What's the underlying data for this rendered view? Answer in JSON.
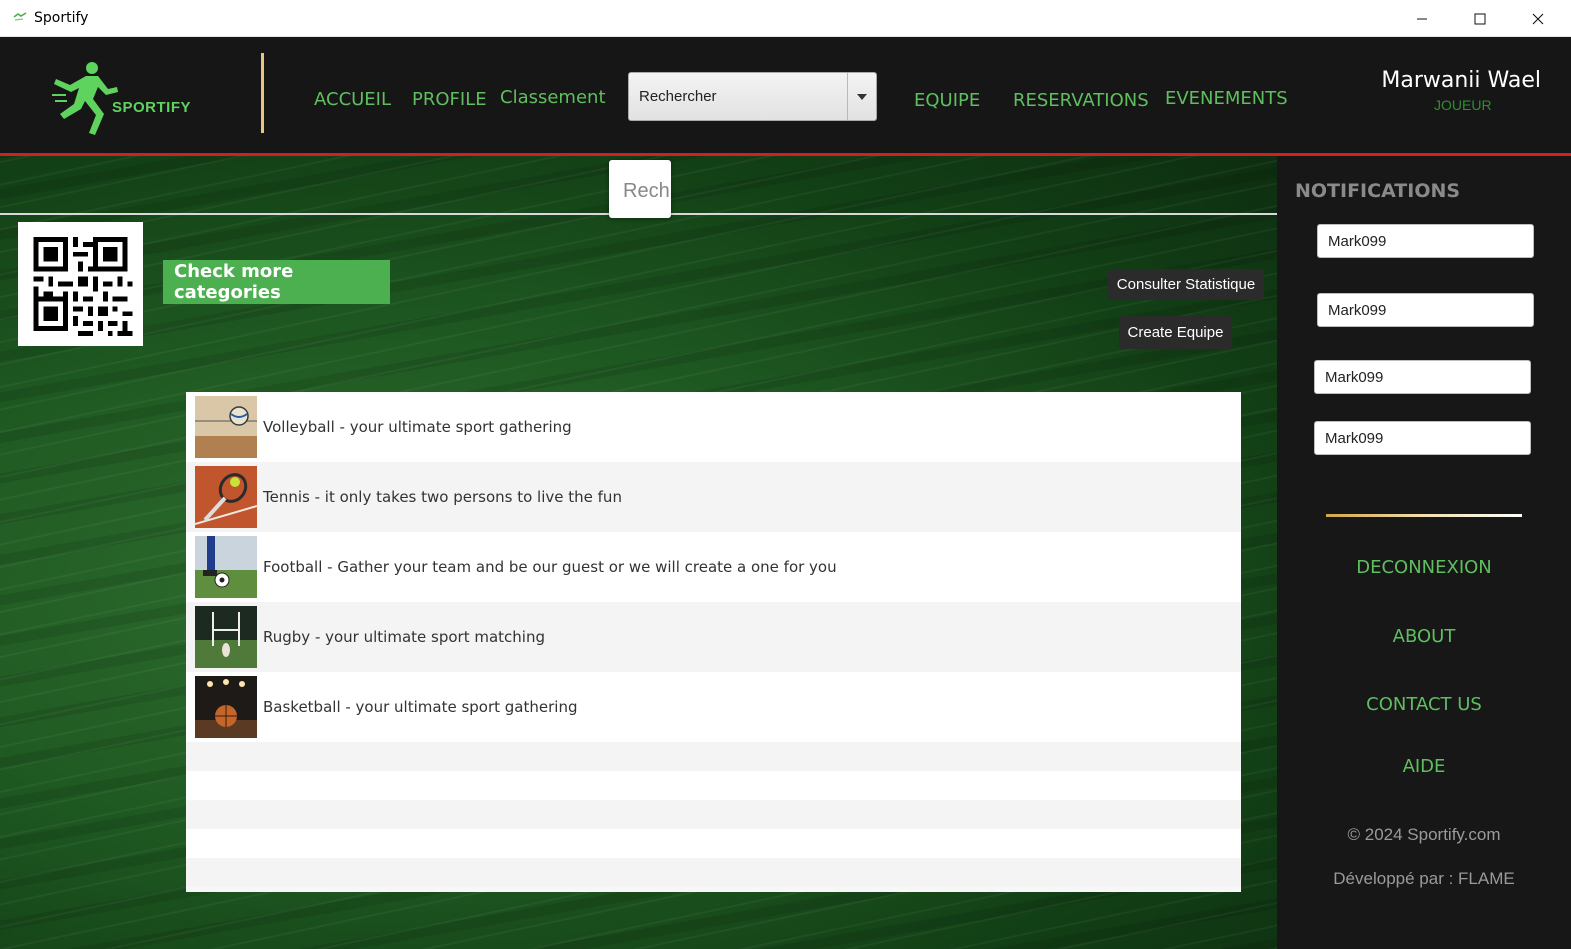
{
  "window": {
    "title": "Sportify"
  },
  "header": {
    "logo_text": "SPORTIFY",
    "nav": {
      "accueil": "ACCUEIL",
      "profile": "PROFILE",
      "classement": "Classement",
      "equipe": "EQUIPE",
      "reservations": "RESERVATIONS",
      "evenements": "EVENEMENTS"
    },
    "search_combo": {
      "value": "Rechercher"
    },
    "user": {
      "name": "Marwanii Wael",
      "role": "JOUEUR"
    }
  },
  "main": {
    "search_placeholder": "Rech",
    "check_categories_label": "Check more categories",
    "consulter_statistique_label": "Consulter Statistique",
    "create_equipe_label": "Create Equipe",
    "categories": [
      {
        "label": "Volleyball - your ultimate sport gathering",
        "thumb_icon": "volleyball-photo"
      },
      {
        "label": "Tennis - it only takes two persons to live the fun",
        "thumb_icon": "tennis-photo"
      },
      {
        "label": "Football - Gather your team and be our guest or we will create a one for you",
        "thumb_icon": "football-photo"
      },
      {
        "label": "Rugby - your ultimate sport matching",
        "thumb_icon": "rugby-photo"
      },
      {
        "label": "Basketball - your ultimate sport gathering",
        "thumb_icon": "basketball-photo"
      }
    ]
  },
  "sidebar": {
    "notifications_title": "NOTIFICATIONS",
    "notifications": [
      "Mark099",
      "Mark099",
      "Mark099",
      "Mark099"
    ],
    "links": {
      "deconnexion": "DECONNEXION",
      "about": "ABOUT",
      "contact": "CONTACT US",
      "aide": "AIDE"
    },
    "copyright": "© 2024 Sportify.com",
    "developer": "Développé par :  FLAME"
  },
  "colors": {
    "accent_green": "#5fbf5f",
    "button_green": "#4caf50",
    "header_red_line": "#d21f1f",
    "divider_gold": "#e7c680"
  }
}
